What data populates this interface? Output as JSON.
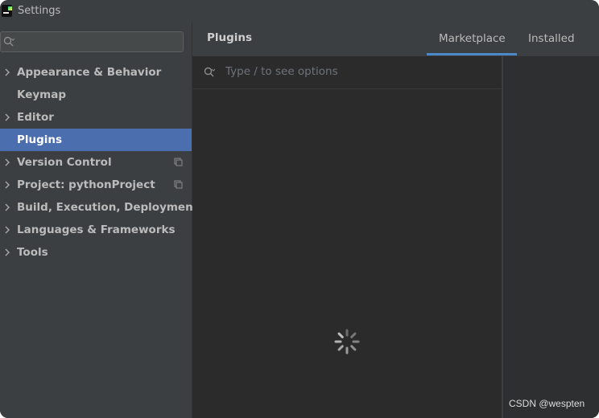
{
  "window": {
    "title": "Settings"
  },
  "sidebar": {
    "search": {
      "placeholder": ""
    },
    "items": [
      {
        "label": "Appearance & Behavior",
        "expandable": true,
        "selected": false,
        "project_scoped": false
      },
      {
        "label": "Keymap",
        "expandable": false,
        "selected": false,
        "project_scoped": false
      },
      {
        "label": "Editor",
        "expandable": true,
        "selected": false,
        "project_scoped": false
      },
      {
        "label": "Plugins",
        "expandable": false,
        "selected": true,
        "project_scoped": false
      },
      {
        "label": "Version Control",
        "expandable": true,
        "selected": false,
        "project_scoped": true
      },
      {
        "label": "Project: pythonProject",
        "expandable": true,
        "selected": false,
        "project_scoped": true
      },
      {
        "label": "Build, Execution, Deployment",
        "expandable": true,
        "selected": false,
        "project_scoped": false
      },
      {
        "label": "Languages & Frameworks",
        "expandable": true,
        "selected": false,
        "project_scoped": false
      },
      {
        "label": "Tools",
        "expandable": true,
        "selected": false,
        "project_scoped": false
      }
    ]
  },
  "main": {
    "title": "Plugins",
    "tabs": [
      {
        "label": "Marketplace",
        "active": true
      },
      {
        "label": "Installed",
        "active": false
      }
    ],
    "search": {
      "placeholder": "Type / to see options"
    },
    "loading": true
  },
  "watermark": "CSDN @wespten",
  "colors": {
    "selection": "#4b6eaf",
    "tab_underline": "#4a88c7",
    "sidebar_bg": "#3c3f41",
    "content_bg": "#2b2b2b"
  },
  "icons": {
    "app": "pycharm-icon",
    "search": "search-icon",
    "expand": "chevron-right-icon",
    "project_scope": "copy-icon",
    "loading": "spinner-icon"
  }
}
